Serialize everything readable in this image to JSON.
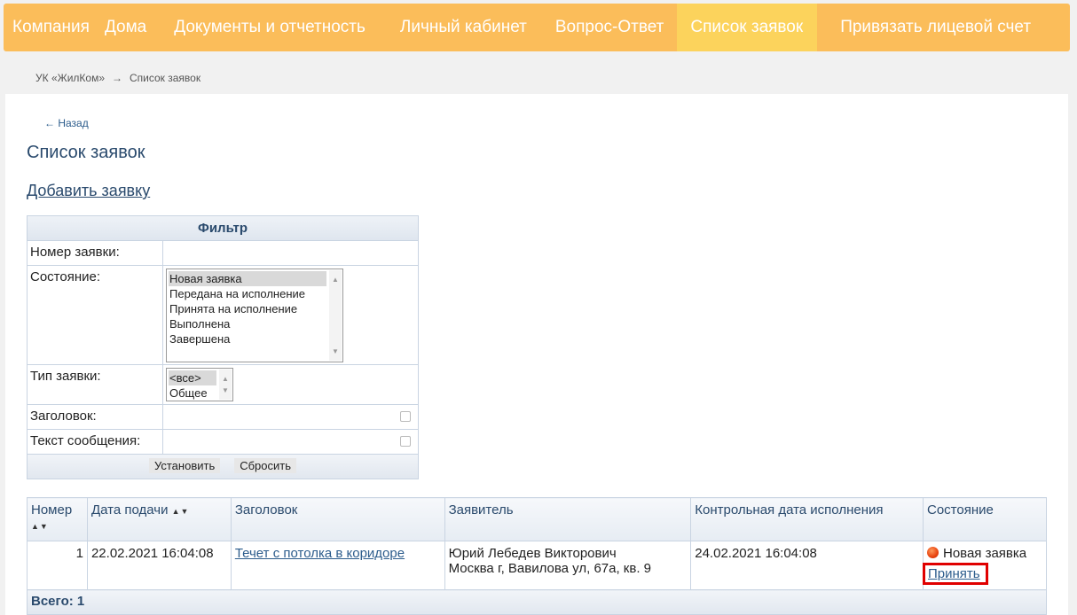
{
  "nav": {
    "items": [
      {
        "label": "Компания",
        "active": false
      },
      {
        "label": "Дома",
        "active": false
      },
      {
        "label": "Документы и отчетность",
        "active": false
      },
      {
        "label": "Личный кабинет",
        "active": false
      },
      {
        "label": "Вопрос-Ответ",
        "active": false
      },
      {
        "label": "Список заявок",
        "active": true
      },
      {
        "label": "Привязать лицевой счет",
        "active": false
      }
    ]
  },
  "breadcrumb": {
    "root": "УК «ЖилКом»",
    "separator": "→",
    "current": "Список заявок"
  },
  "back_link": "← Назад",
  "page_title": "Список заявок",
  "add_link": "Добавить заявку",
  "filter": {
    "title": "Фильтр",
    "number_label": "Номер заявки:",
    "state_label": "Состояние:",
    "state_options": [
      "Новая заявка",
      "Передана на исполнение",
      "Принята на исполнение",
      "Выполнена",
      "Завершена"
    ],
    "state_selected": "Новая заявка",
    "type_label": "Тип заявки:",
    "type_options": [
      "<все>",
      "Общее"
    ],
    "type_selected": "<все>",
    "title_label": "Заголовок:",
    "text_label": "Текст сообщения:",
    "apply_button": "Установить",
    "reset_button": "Сбросить"
  },
  "table": {
    "headers": [
      "Номер",
      "Дата подачи",
      "Заголовок",
      "Заявитель",
      "Контрольная дата исполнения",
      "Состояние"
    ],
    "rows": [
      {
        "number": "1",
        "date": "22.02.2021 16:04:08",
        "title": "Течет с потолка в коридоре",
        "applicant_name": "Юрий Лебедев Викторович",
        "applicant_address": "Москва г, Вавилова ул, 67а, кв. 9",
        "control_date": "24.02.2021 16:04:08",
        "state": "Новая заявка",
        "action": "Принять"
      }
    ],
    "total": "Всего: 1"
  },
  "colors": {
    "nav_bg": "#fbbd5a",
    "nav_active": "#fcd35c",
    "link": "#2c5c8c",
    "highlight": "#e00000"
  }
}
